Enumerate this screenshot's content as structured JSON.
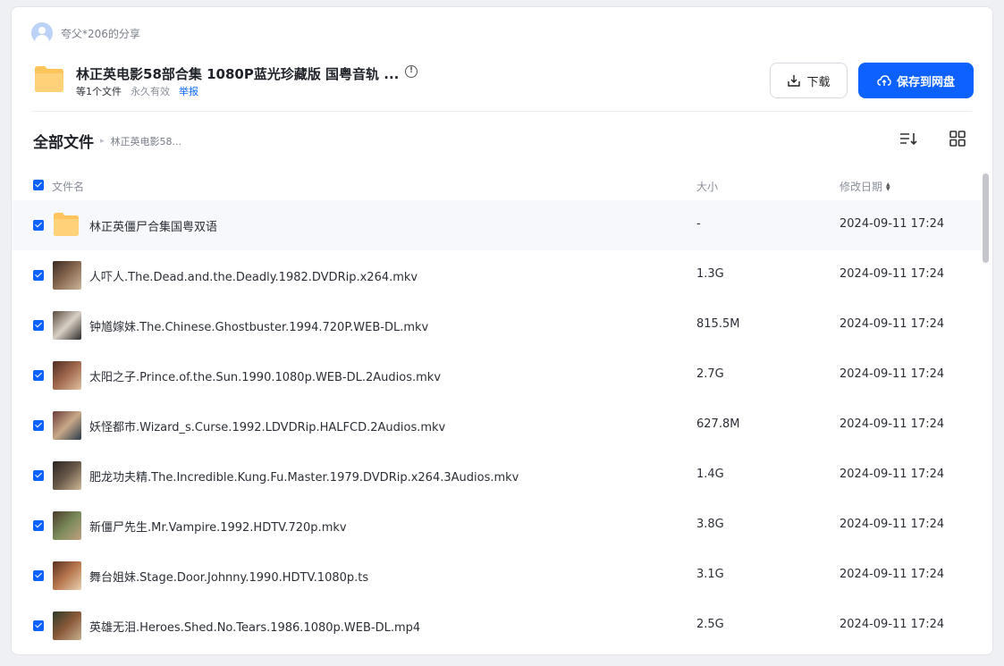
{
  "share": {
    "sharer": "夸父*206的分享",
    "title": "林正英电影58部合集 1080P蓝光珍藏版 国粤音轨 ...",
    "file_count": "等1个文件",
    "validity": "永久有效",
    "report": "举报"
  },
  "actions": {
    "download": "下载",
    "save": "保存到网盘"
  },
  "breadcrumb": {
    "root": "全部文件",
    "sep": "▸",
    "current": "林正英电影58..."
  },
  "table": {
    "col_name": "文件名",
    "col_size": "大小",
    "col_date": "修改日期",
    "rows": [
      {
        "name": "林正英僵尸合集国粤双语",
        "size": "-",
        "date": "2024-09-11 17:24",
        "type": "folder"
      },
      {
        "name": "人吓人.The.Dead.and.the.Deadly.1982.DVDRip.x264.mkv",
        "size": "1.3G",
        "date": "2024-09-11 17:24",
        "type": "video"
      },
      {
        "name": "钟馗嫁妹.The.Chinese.Ghostbuster.1994.720P.WEB-DL.mkv",
        "size": "815.5M",
        "date": "2024-09-11 17:24",
        "type": "video"
      },
      {
        "name": "太阳之子.Prince.of.the.Sun.1990.1080p.WEB-DL.2Audios.mkv",
        "size": "2.7G",
        "date": "2024-09-11 17:24",
        "type": "video"
      },
      {
        "name": "妖怪都市.Wizard_s.Curse.1992.LDVDRip.HALFCD.2Audios.mkv",
        "size": "627.8M",
        "date": "2024-09-11 17:24",
        "type": "video"
      },
      {
        "name": "肥龙功夫精.The.Incredible.Kung.Fu.Master.1979.DVDRip.x264.3Audios.mkv",
        "size": "1.4G",
        "date": "2024-09-11 17:24",
        "type": "video"
      },
      {
        "name": "新僵尸先生.Mr.Vampire.1992.HDTV.720p.mkv",
        "size": "3.8G",
        "date": "2024-09-11 17:24",
        "type": "video"
      },
      {
        "name": "舞台姐妹.Stage.Door.Johnny.1990.HDTV.1080p.ts",
        "size": "3.1G",
        "date": "2024-09-11 17:24",
        "type": "video"
      },
      {
        "name": "英雄无泪.Heroes.Shed.No.Tears.1986.1080p.WEB-DL.mp4",
        "size": "2.5G",
        "date": "2024-09-11 17:24",
        "type": "video"
      }
    ]
  },
  "colors": {
    "accent": "#0d62ff",
    "folder": "#ffc45c"
  }
}
